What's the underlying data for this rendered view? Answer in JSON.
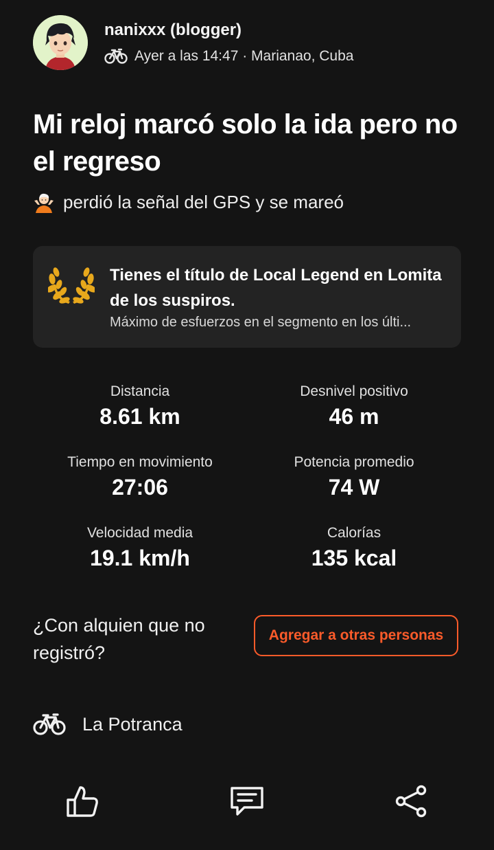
{
  "user": {
    "name": "nanixxx (blogger)",
    "activity_icon": "bike-icon",
    "meta": "Ayer a las 14:47 · Marianao, Cuba"
  },
  "activity": {
    "title": "Mi reloj marcó solo la ida pero no el regreso",
    "subtitle_emoji": "person-shrugging-emoji",
    "subtitle": "perdió la señal del GPS y se mareó"
  },
  "legend_card": {
    "icon": "laurel-wreath-icon",
    "title": "Tienes el título de Local Legend en Lomita de los suspiros.",
    "description": "Máximo de esfuerzos en el segmento en los últi..."
  },
  "stats": [
    {
      "label": "Distancia",
      "value": "8.61 km"
    },
    {
      "label": "Desnivel positivo",
      "value": "46 m"
    },
    {
      "label": "Tiempo en movimiento",
      "value": "27:06"
    },
    {
      "label": "Potencia promedio",
      "value": "74 W"
    },
    {
      "label": "Velocidad media",
      "value": "19.1 km/h"
    },
    {
      "label": "Calorías",
      "value": "135 kcal"
    }
  ],
  "with_others": {
    "prompt": "¿Con alquien que no registró?",
    "button_label": "Agregar a otras personas"
  },
  "gear": {
    "icon": "bike-icon",
    "name": "La Potranca"
  },
  "actions": [
    {
      "icon": "thumbs-up-icon"
    },
    {
      "icon": "comment-icon"
    },
    {
      "icon": "share-icon"
    }
  ],
  "colors": {
    "background": "#141414",
    "card": "#232323",
    "accent": "#fc5b2a",
    "laurel": "#e8a81c"
  }
}
